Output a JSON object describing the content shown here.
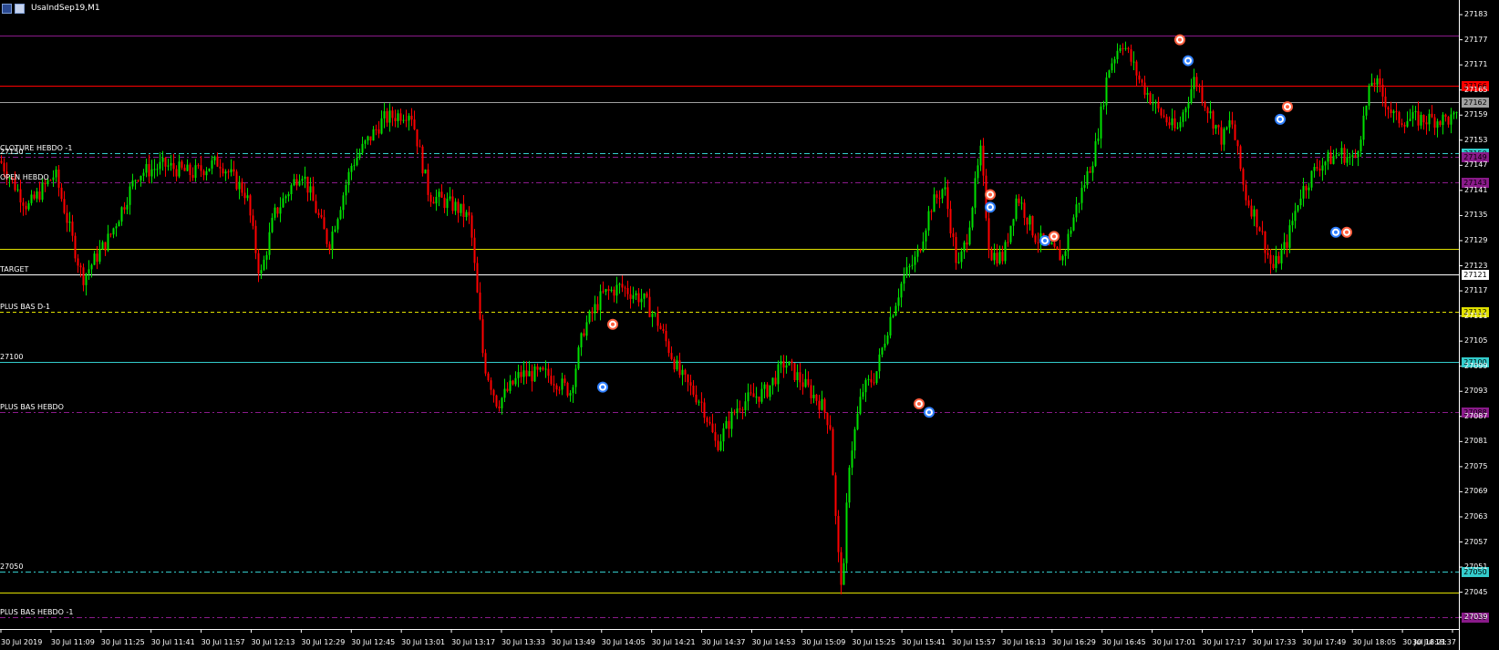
{
  "window": {
    "title": "UsaIndSep19,M1"
  },
  "chart_data": {
    "type": "candlestick",
    "symbol": "UsaIndSep19",
    "timeframe": "M1",
    "price_range": [
      27038,
      27186
    ],
    "y_ticks": [
      "27183",
      "27177",
      "27171",
      "27165",
      "27159",
      "27153",
      "27147",
      "27141",
      "27135",
      "27129",
      "27123",
      "27117",
      "27111",
      "27105",
      "27099",
      "27093",
      "27087",
      "27081",
      "27075",
      "27069",
      "27063",
      "27057",
      "27051",
      "27045",
      "27039"
    ],
    "x_ticks": [
      "30 Jul 2019",
      "30 Jul 11:09",
      "30 Jul 11:25",
      "30 Jul 11:41",
      "30 Jul 11:57",
      "30 Jul 12:13",
      "30 Jul 12:29",
      "30 Jul 12:45",
      "30 Jul 13:01",
      "30 Jul 13:17",
      "30 Jul 13:33",
      "30 Jul 13:49",
      "30 Jul 14:05",
      "30 Jul 14:21",
      "30 Jul 14:37",
      "30 Jul 14:53",
      "30 Jul 15:09",
      "30 Jul 15:25",
      "30 Jul 15:41",
      "30 Jul 15:57",
      "30 Jul 16:13",
      "30 Jul 16:29",
      "30 Jul 16:45",
      "30 Jul 17:01",
      "30 Jul 17:17",
      "30 Jul 17:33",
      "30 Jul 17:49",
      "30 Jul 18:05",
      "30 Jul 18:21",
      "30 Jul 18:37"
    ],
    "levels": [
      {
        "price": 27178,
        "label": "",
        "color": "#8a1a8a",
        "style": "solid",
        "tag": ""
      },
      {
        "price": 27166,
        "label": "",
        "color": "#ff0000",
        "style": "solid",
        "tag": "27166"
      },
      {
        "price": 27162,
        "label": "",
        "color": "#a0a0a0",
        "style": "solid",
        "tag": "27162"
      },
      {
        "price": 27150,
        "label": "CLOTURE HEBDO -1",
        "color": "#33cccc",
        "style": "dashdot",
        "tag": "27150"
      },
      {
        "price": 27149,
        "label": "27150",
        "color": "#8a1a8a",
        "style": "dashdot",
        "tag": "27149"
      },
      {
        "price": 27143,
        "label": "OPEN HEBDO",
        "color": "#8a1a8a",
        "style": "dashdot",
        "tag": "27143"
      },
      {
        "price": 27127,
        "label": "",
        "color": "#e0e000",
        "style": "solid",
        "tag": ""
      },
      {
        "price": 27121,
        "label": "TARGET",
        "color": "#ffffff",
        "style": "solid",
        "tag": "27121"
      },
      {
        "price": 27112,
        "label": "PLUS BAS D-1",
        "color": "#e0e000",
        "style": "dashed",
        "tag": "27112"
      },
      {
        "price": 27100,
        "label": "27100",
        "color": "#33cccc",
        "style": "solid",
        "tag": "27100"
      },
      {
        "price": 27088,
        "label": "PLUS BAS HEBDO",
        "color": "#8a1a8a",
        "style": "dashdot",
        "tag": "27088"
      },
      {
        "price": 27050,
        "label": "27050",
        "color": "#33cccc",
        "style": "dashdot",
        "tag": "27050"
      },
      {
        "price": 27045,
        "label": "",
        "color": "#e0e000",
        "style": "solid",
        "tag": ""
      },
      {
        "price": 27039,
        "label": "PLUS BAS HEBDO -1",
        "color": "#8a1a8a",
        "style": "dashdot",
        "tag": "27039"
      }
    ],
    "path_points": [
      [
        0,
        27148
      ],
      [
        30,
        27137
      ],
      [
        60,
        27145
      ],
      [
        90,
        27120
      ],
      [
        120,
        27130
      ],
      [
        150,
        27145
      ],
      [
        180,
        27147
      ],
      [
        210,
        27145
      ],
      [
        240,
        27148
      ],
      [
        270,
        27140
      ],
      [
        285,
        27120
      ],
      [
        300,
        27135
      ],
      [
        330,
        27146
      ],
      [
        360,
        27128
      ],
      [
        385,
        27147
      ],
      [
        400,
        27152
      ],
      [
        420,
        27158
      ],
      [
        450,
        27160
      ],
      [
        470,
        27140
      ],
      [
        500,
        27137
      ],
      [
        515,
        27134
      ],
      [
        530,
        27100
      ],
      [
        545,
        27090
      ],
      [
        570,
        27097
      ],
      [
        600,
        27097
      ],
      [
        625,
        27093
      ],
      [
        640,
        27108
      ],
      [
        660,
        27116
      ],
      [
        680,
        27118
      ],
      [
        705,
        27115
      ],
      [
        720,
        27110
      ],
      [
        745,
        27097
      ],
      [
        770,
        27090
      ],
      [
        785,
        27080
      ],
      [
        810,
        27090
      ],
      [
        840,
        27093
      ],
      [
        860,
        27100
      ],
      [
        880,
        27095
      ],
      [
        900,
        27090
      ],
      [
        910,
        27085
      ],
      [
        918,
        27055
      ],
      [
        924,
        27045
      ],
      [
        930,
        27075
      ],
      [
        945,
        27093
      ],
      [
        960,
        27097
      ],
      [
        975,
        27110
      ],
      [
        990,
        27120
      ],
      [
        1005,
        27125
      ],
      [
        1020,
        27137
      ],
      [
        1035,
        27142
      ],
      [
        1050,
        27122
      ],
      [
        1060,
        27130
      ],
      [
        1075,
        27150
      ],
      [
        1085,
        27126
      ],
      [
        1100,
        27125
      ],
      [
        1115,
        27140
      ],
      [
        1135,
        27130
      ],
      [
        1150,
        27127
      ],
      [
        1165,
        27125
      ],
      [
        1180,
        27137
      ],
      [
        1200,
        27150
      ],
      [
        1215,
        27170
      ],
      [
        1230,
        27177
      ],
      [
        1250,
        27167
      ],
      [
        1270,
        27160
      ],
      [
        1290,
        27155
      ],
      [
        1310,
        27168
      ],
      [
        1325,
        27160
      ],
      [
        1340,
        27153
      ],
      [
        1350,
        27158
      ],
      [
        1365,
        27140
      ],
      [
        1380,
        27133
      ],
      [
        1395,
        27122
      ],
      [
        1410,
        27128
      ],
      [
        1425,
        27140
      ],
      [
        1445,
        27147
      ],
      [
        1470,
        27150
      ],
      [
        1485,
        27148
      ],
      [
        1495,
        27158
      ],
      [
        1505,
        27168
      ],
      [
        1520,
        27162
      ],
      [
        1530,
        27158
      ]
    ],
    "markers": [
      {
        "x": 1294,
        "price": 27177,
        "kind": "sell",
        "color": "#ff6040"
      },
      {
        "x": 1303,
        "price": 27172,
        "kind": "buy",
        "color": "#3080ff"
      },
      {
        "x": 1086,
        "price": 27140,
        "kind": "sell",
        "color": "#ff6040"
      },
      {
        "x": 1086,
        "price": 27137,
        "kind": "buy",
        "color": "#3080ff"
      },
      {
        "x": 1146,
        "price": 27129,
        "kind": "buy",
        "color": "#3080ff"
      },
      {
        "x": 1156,
        "price": 27130,
        "kind": "sell",
        "color": "#ff6040"
      },
      {
        "x": 1404,
        "price": 27158,
        "kind": "buy",
        "color": "#3080ff"
      },
      {
        "x": 1412,
        "price": 27161,
        "kind": "sell",
        "color": "#ff6040"
      },
      {
        "x": 1465,
        "price": 27131,
        "kind": "buy",
        "color": "#3080ff"
      },
      {
        "x": 1477,
        "price": 27131,
        "kind": "sell",
        "color": "#ff6040"
      },
      {
        "x": 672,
        "price": 27109,
        "kind": "sell",
        "color": "#ff6040"
      },
      {
        "x": 661,
        "price": 27094,
        "kind": "buy",
        "color": "#3080ff"
      },
      {
        "x": 1008,
        "price": 27090,
        "kind": "sell",
        "color": "#ff6040"
      },
      {
        "x": 1019,
        "price": 27088,
        "kind": "buy",
        "color": "#3080ff"
      }
    ],
    "grid": false,
    "up_color": "#00e000",
    "down_color": "#ff0000"
  }
}
